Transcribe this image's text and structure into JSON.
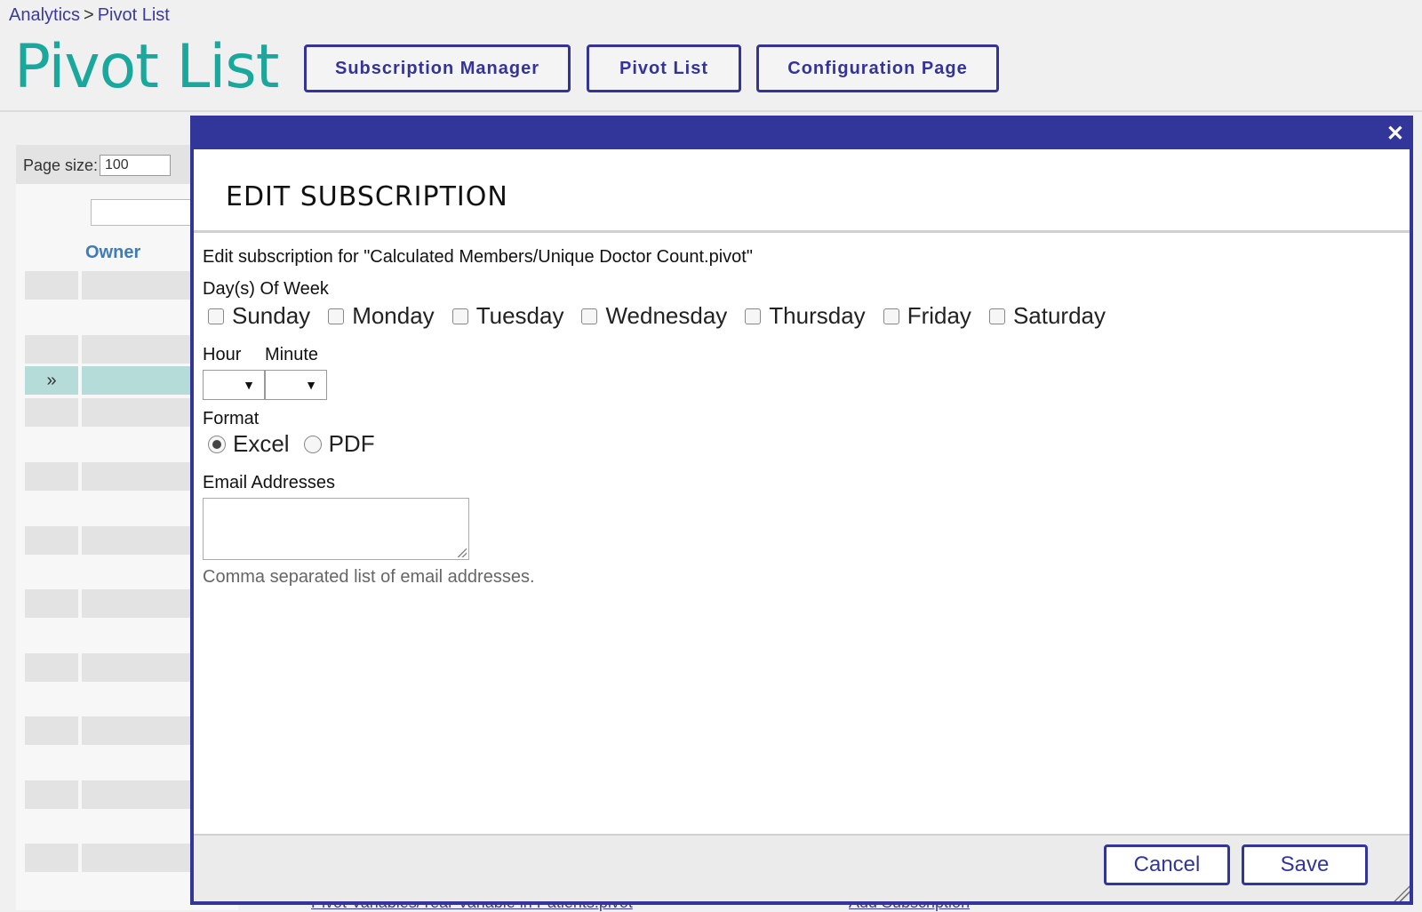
{
  "breadcrumb": {
    "root": "Analytics",
    "separator": ">",
    "current": "Pivot List"
  },
  "page_title": "Pivot List",
  "header_buttons": {
    "subscription_manager": "Subscription Manager",
    "pivot_list": "Pivot List",
    "configuration_page": "Configuration Page"
  },
  "background": {
    "page_size_label": "Page size:",
    "page_size_value": "100",
    "owner_header": "Owner",
    "selected_row_marker": "»",
    "footer_link_left": "Pivot Variables/Year Variable in Patients.pivot",
    "footer_link_right": "Add Subscription"
  },
  "modal": {
    "close_icon": "close-icon",
    "heading": "EDIT SUBSCRIPTION",
    "description": "Edit subscription for \"Calculated Members/Unique Doctor Count.pivot\"",
    "days_label": "Day(s) Of Week",
    "days": [
      "Sunday",
      "Monday",
      "Tuesday",
      "Wednesday",
      "Thursday",
      "Friday",
      "Saturday"
    ],
    "hour_label": "Hour",
    "minute_label": "Minute",
    "hour_value": "",
    "minute_value": "",
    "format_label": "Format",
    "formats": [
      "Excel",
      "PDF"
    ],
    "selected_format": "Excel",
    "email_label": "Email Addresses",
    "email_value": "",
    "email_help": "Comma separated list of email addresses.",
    "cancel_label": "Cancel",
    "save_label": "Save"
  },
  "colors": {
    "accent": "#32369a",
    "title_teal": "#1aa89c",
    "selected_row": "#b6dcd9"
  }
}
